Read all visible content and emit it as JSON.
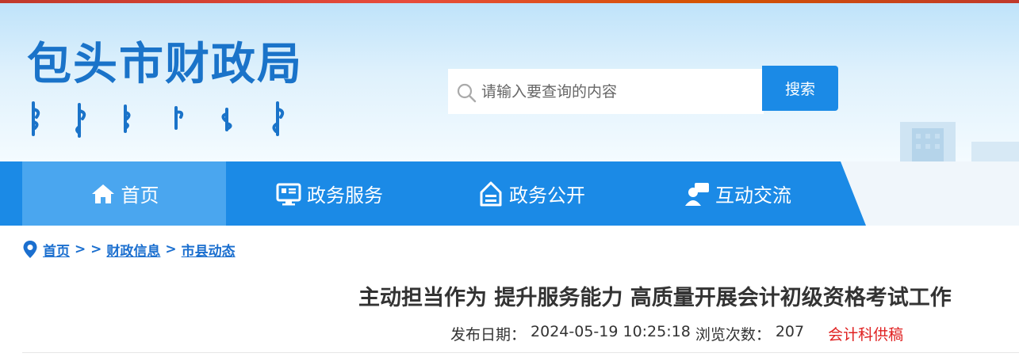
{
  "header": {
    "site_title": "包头市财政局",
    "mongolian_text_image": "mongolian-script-logo"
  },
  "search": {
    "placeholder": "请输入要查询的内容",
    "button_label": "搜索"
  },
  "nav": {
    "items": [
      {
        "label": "首页",
        "icon": "home-icon",
        "active": true
      },
      {
        "label": "政务服务",
        "icon": "monitor-icon",
        "active": false
      },
      {
        "label": "政务公开",
        "icon": "open-tray-icon",
        "active": false
      },
      {
        "label": "互动交流",
        "icon": "user-chat-icon",
        "active": false
      }
    ]
  },
  "breadcrumb": {
    "home": "首页",
    "sep1": "> >",
    "level1": "财政信息",
    "sep2": ">",
    "level2": "市县动态"
  },
  "article": {
    "title": "主动担当作为 提升服务能力 高质量开展会计初级资格考试工作",
    "publish_label": "发布日期：",
    "publish_date": "2024-05-19 10:25:18",
    "views_label": "浏览次数：",
    "views": "207",
    "source": "会计科供稿"
  },
  "colors": {
    "brand_blue": "#1b8ae6",
    "nav_active": "#4aa6ef",
    "title_blue": "#1a73c9",
    "source_red": "#e02020"
  }
}
